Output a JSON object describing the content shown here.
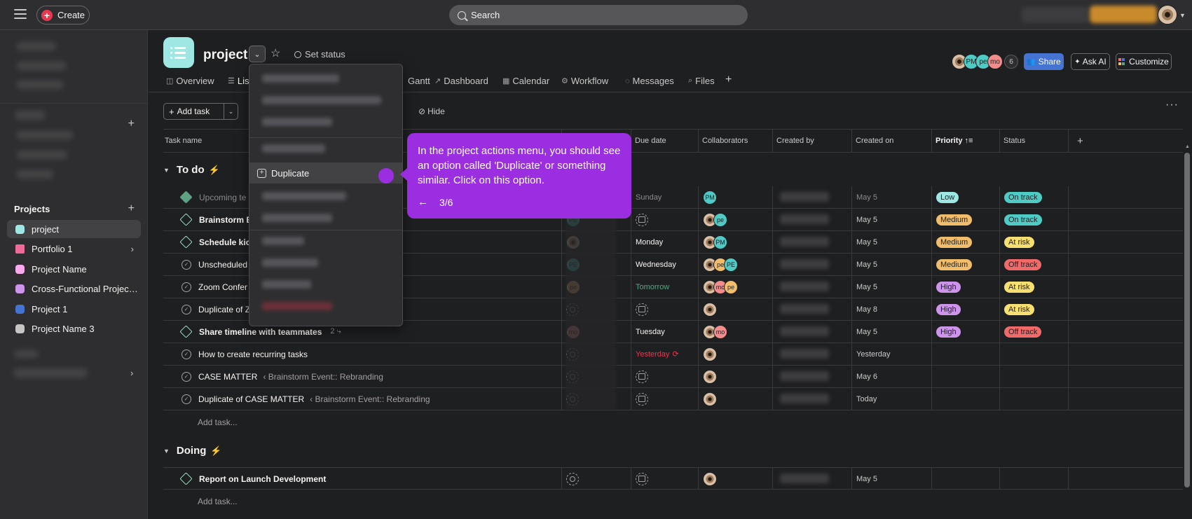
{
  "topbar": {
    "create_label": "Create",
    "search_placeholder": "Search"
  },
  "sidebar": {
    "projects_heading": "Projects",
    "projects": [
      {
        "label": "project",
        "color": "#9ee7e3",
        "active": true
      },
      {
        "label": "Portfolio 1",
        "color": "#f06a99",
        "folder": true
      },
      {
        "label": "Project Name",
        "color": "#f9aaef"
      },
      {
        "label": "Cross-Functional Project P...",
        "color": "#cd95ea"
      },
      {
        "label": "Project 1",
        "color": "#4573d2"
      },
      {
        "label": "Project Name 3",
        "color": "#c7c4c4"
      }
    ]
  },
  "header": {
    "title": "project",
    "set_status": "Set status",
    "share": "Share",
    "ask_ai": "Ask AI",
    "customize": "Customize",
    "member_avatars": [
      {
        "initials": "",
        "color": "photo"
      },
      {
        "initials": "PM",
        "color": "#4ecbc4"
      },
      {
        "initials": "pe",
        "color": "#4ecbc4"
      },
      {
        "initials": "mo",
        "color": "#f48c8c"
      }
    ],
    "member_count": "6"
  },
  "tabs": [
    {
      "label": "Overview",
      "icon": "◫"
    },
    {
      "label": "List",
      "icon": "☰",
      "active": true
    },
    {
      "label": "Gantt",
      "icon": ""
    },
    {
      "label": "Dashboard",
      "icon": "↗"
    },
    {
      "label": "Calendar",
      "icon": "▦"
    },
    {
      "label": "Workflow",
      "icon": "⚙"
    },
    {
      "label": "Messages",
      "icon": "◌"
    },
    {
      "label": "Files",
      "icon": "⌕"
    }
  ],
  "toolbar": {
    "add_task": "Add task",
    "hide": "Hide"
  },
  "columns": {
    "task_name": "Task name",
    "due_date": "Due date",
    "collaborators": "Collaborators",
    "created_by": "Created by",
    "created_on": "Created on",
    "priority": "Priority",
    "status": "Status"
  },
  "sections": [
    {
      "name": "To do"
    },
    {
      "name": "Doing"
    }
  ],
  "add_task_row": "Add task...",
  "tasks": [
    {
      "name": "Upcoming te",
      "due": "Sunday",
      "created_on": "May 5",
      "priority": "Low",
      "status": "On track"
    },
    {
      "name": "Brainstorm E",
      "due": "",
      "created_on": "May 5",
      "priority": "Medium",
      "status": "On track"
    },
    {
      "name": "Schedule kick",
      "due": "Monday",
      "created_on": "May 5",
      "priority": "Medium",
      "status": "At risk"
    },
    {
      "name": "Unscheduled",
      "due": "Wednesday",
      "created_on": "May 5",
      "priority": "Medium",
      "status": "Off track"
    },
    {
      "name": "Zoom Confer",
      "due": "Tomorrow",
      "created_on": "May 5",
      "priority": "High",
      "status": "At risk"
    },
    {
      "name": "Duplicate of Z",
      "due": "",
      "created_on": "May 8",
      "priority": "High",
      "status": "At risk"
    },
    {
      "name": "Share timeline with teammates",
      "subtasks": "2",
      "due": "Tuesday",
      "created_on": "May 5",
      "priority": "High",
      "status": "Off track"
    },
    {
      "name": "How to create recurring tasks",
      "due": "Yesterday",
      "created_on": "Yesterday",
      "priority": "",
      "status": ""
    },
    {
      "name": "CASE MATTER",
      "crumb": "‹ Brainstorm Event:: Rebranding",
      "due": "",
      "created_on": "May 6",
      "priority": "",
      "status": ""
    },
    {
      "name": "Duplicate of CASE MATTER",
      "crumb": "‹ Brainstorm Event:: Rebranding",
      "due": "",
      "created_on": "Today",
      "priority": "",
      "status": ""
    },
    {
      "name": "Report on Launch Development",
      "due": "",
      "created_on": "May 5",
      "priority": "",
      "status": ""
    }
  ],
  "menu": {
    "duplicate": "Duplicate"
  },
  "tooltip": {
    "text": "In the project actions menu, you should see an option called 'Duplicate' or something similar. Click on this option.",
    "step": "3/6"
  },
  "colors": {
    "priority_low": "#9ee7e3",
    "priority_medium": "#f1bd6c",
    "priority_high": "#cd95ea",
    "status_on_track": "#4ecbc4",
    "status_at_risk": "#f8df72",
    "status_off_track": "#f06a6a",
    "accent": "#9a2ee0"
  }
}
